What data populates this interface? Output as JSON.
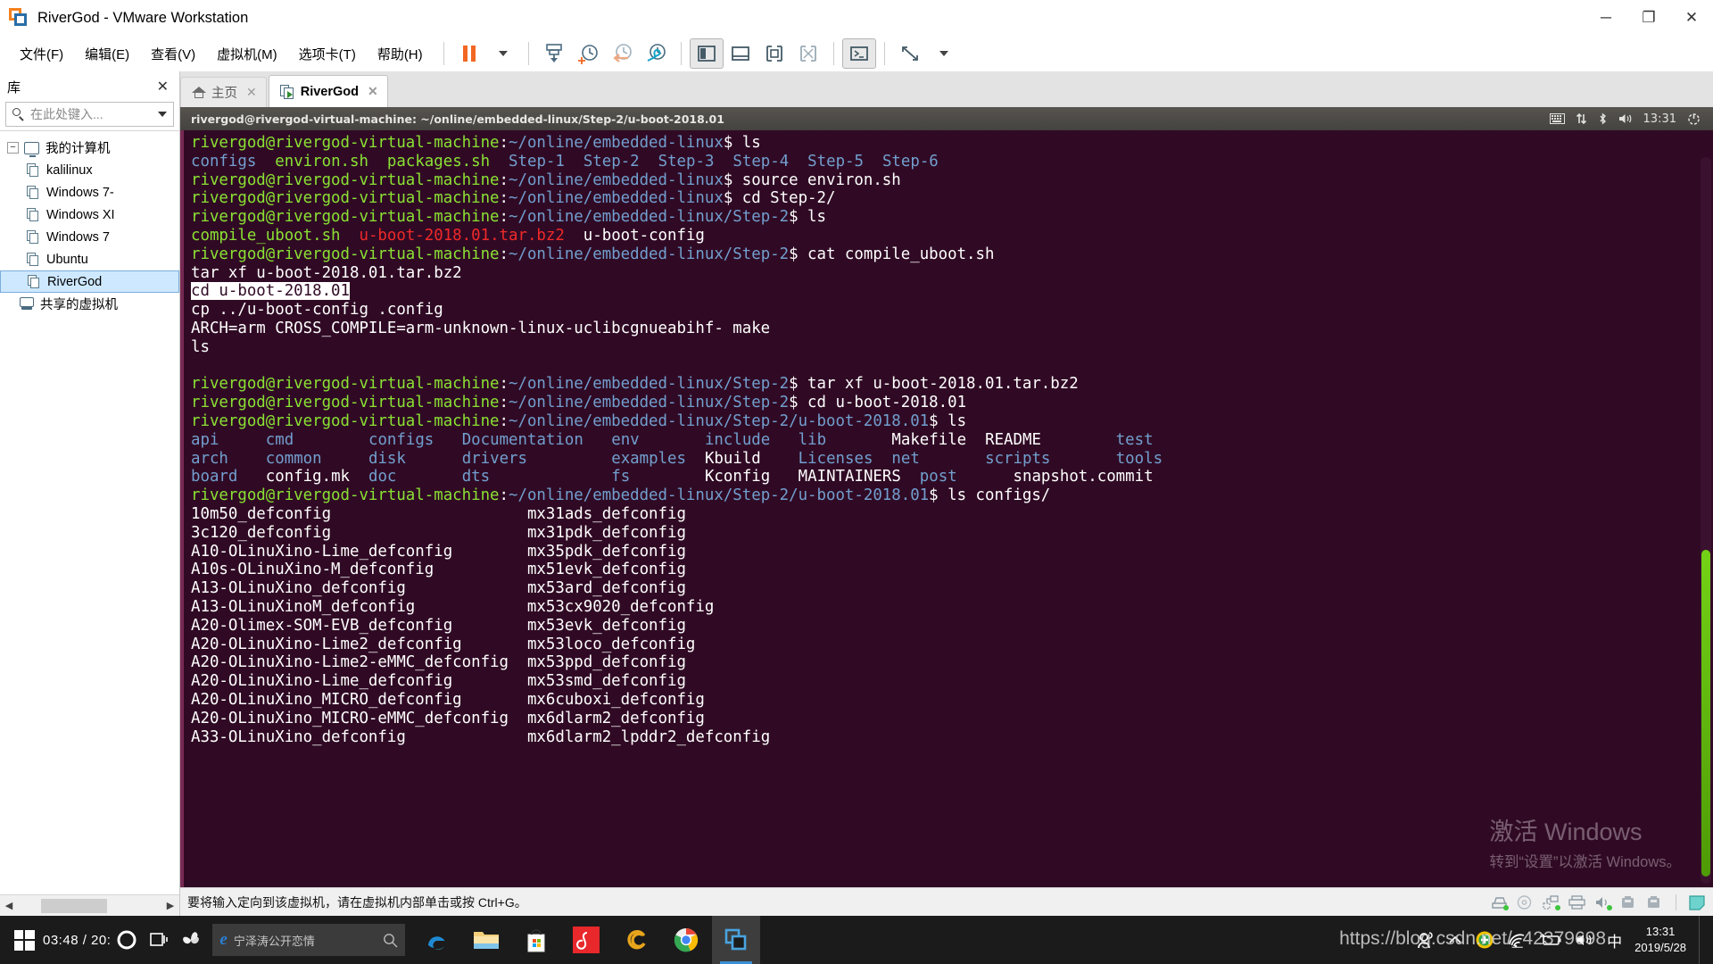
{
  "window": {
    "title": "RiverGod - VMware Workstation",
    "app_icon": "vmware-logo-icon",
    "minimize": "─",
    "maximize": "❐",
    "close": "✕"
  },
  "menubar": {
    "items": [
      {
        "label": "文件(F)",
        "name": "menu-file"
      },
      {
        "label": "编辑(E)",
        "name": "menu-edit"
      },
      {
        "label": "查看(V)",
        "name": "menu-view"
      },
      {
        "label": "虚拟机(M)",
        "name": "menu-vm"
      },
      {
        "label": "选项卡(T)",
        "name": "menu-tabs"
      },
      {
        "label": "帮助(H)",
        "name": "menu-help"
      }
    ],
    "toolbar": [
      {
        "name": "pause-button",
        "icon": "pause-icon"
      },
      {
        "name": "power-dropdown",
        "icon": "chevron-down-icon"
      },
      {
        "name": "send-ctrl-alt-del-button",
        "icon": "send-keys-icon"
      },
      {
        "name": "take-snapshot-button",
        "icon": "snapshot-add-icon"
      },
      {
        "name": "revert-snapshot-button",
        "icon": "snapshot-revert-icon"
      },
      {
        "name": "snapshot-manager-button",
        "icon": "snapshot-manager-icon"
      },
      {
        "name": "show-library-button",
        "icon": "panel-left-icon"
      },
      {
        "name": "show-thumbnails-button",
        "icon": "panel-bottom-icon"
      },
      {
        "name": "show-console-view-button",
        "icon": "console-view-icon"
      },
      {
        "name": "hide-all-panels-button",
        "icon": "panel-hide-icon"
      },
      {
        "name": "unity-mode-button",
        "icon": "terminal-box-icon"
      },
      {
        "name": "fullscreen-button",
        "icon": "fullscreen-icon"
      },
      {
        "name": "fullscreen-dropdown",
        "icon": "chevron-down-icon"
      }
    ]
  },
  "library": {
    "header": "库",
    "close_icon": "close-icon",
    "search_placeholder": "在此处键入...",
    "search_value": "",
    "search_icon": "search-icon",
    "dropdown_icon": "chevron-down-icon",
    "root": {
      "label": "我的计算机",
      "expander": "−",
      "icon": "my-computer-icon"
    },
    "items": [
      {
        "label": "kalilinux",
        "icon": "vm-icon",
        "selected": false
      },
      {
        "label": "Windows 7-",
        "icon": "vm-icon",
        "selected": false
      },
      {
        "label": "Windows XI",
        "icon": "vm-icon",
        "selected": false
      },
      {
        "label": "Windows 7",
        "icon": "vm-icon",
        "selected": false
      },
      {
        "label": "Ubuntu",
        "icon": "vm-icon",
        "selected": false
      },
      {
        "label": "RiverGod",
        "icon": "vm-icon",
        "selected": true
      }
    ],
    "shared": {
      "label": "共享的虚拟机",
      "icon": "shared-vms-icon"
    },
    "scroll_left_icon": "◀",
    "scroll_right_icon": "▶"
  },
  "tabs": [
    {
      "label": "主页",
      "icon": "home-icon",
      "close": "✕",
      "active": false,
      "name": "tab-home"
    },
    {
      "label": "RiverGod",
      "icon": "vm-tab-icon",
      "close": "✕",
      "active": true,
      "name": "tab-rivergod"
    }
  ],
  "guest": {
    "titlebar_text": "rivergod@rivergod-virtual-machine: ~/online/embedded-linux/Step-2/u-boot-2018.01",
    "tray": [
      {
        "name": "keyboard-indicator-icon",
        "glyph": "⌨"
      },
      {
        "name": "network-indicator-icon",
        "glyph": "⇅"
      },
      {
        "name": "bluetooth-indicator-icon",
        "glyph": "✶"
      },
      {
        "name": "volume-indicator-icon",
        "glyph": "🔊"
      }
    ],
    "clock": "13:31",
    "power_icon": "power-gear-icon",
    "watermark": {
      "line1": "激活 Windows",
      "line2": "转到“设置”以激活 Windows。"
    },
    "prompt_user": "rivergod@rivergod-virtual-machine",
    "terminal_lines": [
      [
        {
          "t": "rivergod@rivergod-virtual-machine",
          "c": "green"
        },
        {
          "t": ":",
          "c": "white"
        },
        {
          "t": "~/online/embedded-linux",
          "c": "blue"
        },
        {
          "t": "$ ls",
          "c": "white"
        }
      ],
      [
        {
          "t": "configs",
          "c": "blue"
        },
        {
          "t": "  ",
          "c": "white"
        },
        {
          "t": "environ.sh",
          "c": "green"
        },
        {
          "t": "  ",
          "c": "white"
        },
        {
          "t": "packages.sh",
          "c": "green"
        },
        {
          "t": "  ",
          "c": "white"
        },
        {
          "t": "Step-1",
          "c": "blue"
        },
        {
          "t": "  ",
          "c": "white"
        },
        {
          "t": "Step-2",
          "c": "blue"
        },
        {
          "t": "  ",
          "c": "white"
        },
        {
          "t": "Step-3",
          "c": "blue"
        },
        {
          "t": "  ",
          "c": "white"
        },
        {
          "t": "Step-4",
          "c": "blue"
        },
        {
          "t": "  ",
          "c": "white"
        },
        {
          "t": "Step-5",
          "c": "blue"
        },
        {
          "t": "  ",
          "c": "white"
        },
        {
          "t": "Step-6",
          "c": "blue"
        }
      ],
      [
        {
          "t": "rivergod@rivergod-virtual-machine",
          "c": "green"
        },
        {
          "t": ":",
          "c": "white"
        },
        {
          "t": "~/online/embedded-linux",
          "c": "blue"
        },
        {
          "t": "$ source environ.sh",
          "c": "white"
        }
      ],
      [
        {
          "t": "rivergod@rivergod-virtual-machine",
          "c": "green"
        },
        {
          "t": ":",
          "c": "white"
        },
        {
          "t": "~/online/embedded-linux",
          "c": "blue"
        },
        {
          "t": "$ cd Step-2/",
          "c": "white"
        }
      ],
      [
        {
          "t": "rivergod@rivergod-virtual-machine",
          "c": "green"
        },
        {
          "t": ":",
          "c": "white"
        },
        {
          "t": "~/online/embedded-linux/Step-2",
          "c": "blue"
        },
        {
          "t": "$ ls",
          "c": "white"
        }
      ],
      [
        {
          "t": "compile_uboot.sh",
          "c": "green"
        },
        {
          "t": "  ",
          "c": "white"
        },
        {
          "t": "u-boot-2018.01.tar.bz2",
          "c": "red"
        },
        {
          "t": "  ",
          "c": "white"
        },
        {
          "t": "u-boot-config",
          "c": "white"
        }
      ],
      [
        {
          "t": "rivergod@rivergod-virtual-machine",
          "c": "green"
        },
        {
          "t": ":",
          "c": "white"
        },
        {
          "t": "~/online/embedded-linux/Step-2",
          "c": "blue"
        },
        {
          "t": "$ cat compile_uboot.sh",
          "c": "white"
        }
      ],
      [
        {
          "t": "tar xf u-boot-2018.01.tar.bz2",
          "c": "white"
        }
      ],
      [
        {
          "t": "cd u-boot-2018.01",
          "c": "sel"
        }
      ],
      [
        {
          "t": "cp ../u-boot-config .config",
          "c": "white"
        }
      ],
      [
        {
          "t": "ARCH=arm CROSS_COMPILE=arm-unknown-linux-uclibcgnueabihf- make",
          "c": "white"
        }
      ],
      [
        {
          "t": "ls",
          "c": "white"
        }
      ],
      [
        {
          "t": "",
          "c": "white"
        }
      ],
      [
        {
          "t": "rivergod@rivergod-virtual-machine",
          "c": "green"
        },
        {
          "t": ":",
          "c": "white"
        },
        {
          "t": "~/online/embedded-linux/Step-2",
          "c": "blue"
        },
        {
          "t": "$ tar xf u-boot-2018.01.tar.bz2",
          "c": "white"
        }
      ],
      [
        {
          "t": "rivergod@rivergod-virtual-machine",
          "c": "green"
        },
        {
          "t": ":",
          "c": "white"
        },
        {
          "t": "~/online/embedded-linux/Step-2",
          "c": "blue"
        },
        {
          "t": "$ cd u-boot-2018.01",
          "c": "white"
        }
      ],
      [
        {
          "t": "rivergod@rivergod-virtual-machine",
          "c": "green"
        },
        {
          "t": ":",
          "c": "white"
        },
        {
          "t": "~/online/embedded-linux/Step-2/u-boot-2018.01",
          "c": "blue"
        },
        {
          "t": "$ ls",
          "c": "white"
        }
      ],
      [
        {
          "t": "api",
          "c": "blue"
        },
        {
          "t": "     ",
          "c": "white"
        },
        {
          "t": "cmd",
          "c": "blue"
        },
        {
          "t": "        ",
          "c": "white"
        },
        {
          "t": "configs",
          "c": "blue"
        },
        {
          "t": "   ",
          "c": "white"
        },
        {
          "t": "Documentation",
          "c": "blue"
        },
        {
          "t": "   ",
          "c": "white"
        },
        {
          "t": "env",
          "c": "blue"
        },
        {
          "t": "       ",
          "c": "white"
        },
        {
          "t": "include",
          "c": "blue"
        },
        {
          "t": "   ",
          "c": "white"
        },
        {
          "t": "lib",
          "c": "blue"
        },
        {
          "t": "       ",
          "c": "white"
        },
        {
          "t": "Makefile",
          "c": "white"
        },
        {
          "t": "  ",
          "c": "white"
        },
        {
          "t": "README",
          "c": "white"
        },
        {
          "t": "        ",
          "c": "white"
        },
        {
          "t": "test",
          "c": "blue"
        }
      ],
      [
        {
          "t": "arch",
          "c": "blue"
        },
        {
          "t": "    ",
          "c": "white"
        },
        {
          "t": "common",
          "c": "blue"
        },
        {
          "t": "     ",
          "c": "white"
        },
        {
          "t": "disk",
          "c": "blue"
        },
        {
          "t": "      ",
          "c": "white"
        },
        {
          "t": "drivers",
          "c": "blue"
        },
        {
          "t": "         ",
          "c": "white"
        },
        {
          "t": "examples",
          "c": "blue"
        },
        {
          "t": "  ",
          "c": "white"
        },
        {
          "t": "Kbuild",
          "c": "white"
        },
        {
          "t": "    ",
          "c": "white"
        },
        {
          "t": "Licenses",
          "c": "blue"
        },
        {
          "t": "  ",
          "c": "white"
        },
        {
          "t": "net",
          "c": "blue"
        },
        {
          "t": "       ",
          "c": "white"
        },
        {
          "t": "scripts",
          "c": "blue"
        },
        {
          "t": "       ",
          "c": "white"
        },
        {
          "t": "tools",
          "c": "blue"
        }
      ],
      [
        {
          "t": "board",
          "c": "blue"
        },
        {
          "t": "   ",
          "c": "white"
        },
        {
          "t": "config.mk",
          "c": "white"
        },
        {
          "t": "  ",
          "c": "white"
        },
        {
          "t": "doc",
          "c": "blue"
        },
        {
          "t": "       ",
          "c": "white"
        },
        {
          "t": "dts",
          "c": "blue"
        },
        {
          "t": "             ",
          "c": "white"
        },
        {
          "t": "fs",
          "c": "blue"
        },
        {
          "t": "        ",
          "c": "white"
        },
        {
          "t": "Kconfig",
          "c": "white"
        },
        {
          "t": "   ",
          "c": "white"
        },
        {
          "t": "MAINTAINERS",
          "c": "white"
        },
        {
          "t": "  ",
          "c": "white"
        },
        {
          "t": "post",
          "c": "blue"
        },
        {
          "t": "      ",
          "c": "white"
        },
        {
          "t": "snapshot.commit",
          "c": "white"
        }
      ],
      [
        {
          "t": "rivergod@rivergod-virtual-machine",
          "c": "green"
        },
        {
          "t": ":",
          "c": "white"
        },
        {
          "t": "~/online/embedded-linux/Step-2/u-boot-2018.01",
          "c": "blue"
        },
        {
          "t": "$ ls configs/",
          "c": "white"
        }
      ],
      [
        {
          "t": "10m50_defconfig",
          "c": "white"
        },
        {
          "t": "                     ",
          "c": "white"
        },
        {
          "t": "mx31ads_defconfig",
          "c": "white"
        }
      ],
      [
        {
          "t": "3c120_defconfig",
          "c": "white"
        },
        {
          "t": "                     ",
          "c": "white"
        },
        {
          "t": "mx31pdk_defconfig",
          "c": "white"
        }
      ],
      [
        {
          "t": "A10-OLinuXino-Lime_defconfig",
          "c": "white"
        },
        {
          "t": "        ",
          "c": "white"
        },
        {
          "t": "mx35pdk_defconfig",
          "c": "white"
        }
      ],
      [
        {
          "t": "A10s-OLinuXino-M_defconfig",
          "c": "white"
        },
        {
          "t": "          ",
          "c": "white"
        },
        {
          "t": "mx51evk_defconfig",
          "c": "white"
        }
      ],
      [
        {
          "t": "A13-OLinuXino_defconfig",
          "c": "white"
        },
        {
          "t": "             ",
          "c": "white"
        },
        {
          "t": "mx53ard_defconfig",
          "c": "white"
        }
      ],
      [
        {
          "t": "A13-OLinuXinoM_defconfig",
          "c": "white"
        },
        {
          "t": "            ",
          "c": "white"
        },
        {
          "t": "mx53cx9020_defconfig",
          "c": "white"
        }
      ],
      [
        {
          "t": "A20-Olimex-SOM-EVB_defconfig",
          "c": "white"
        },
        {
          "t": "        ",
          "c": "white"
        },
        {
          "t": "mx53evk_defconfig",
          "c": "white"
        }
      ],
      [
        {
          "t": "A20-OLinuXino-Lime2_defconfig",
          "c": "white"
        },
        {
          "t": "       ",
          "c": "white"
        },
        {
          "t": "mx53loco_defconfig",
          "c": "white"
        }
      ],
      [
        {
          "t": "A20-OLinuXino-Lime2-eMMC_defconfig",
          "c": "white"
        },
        {
          "t": "  ",
          "c": "white"
        },
        {
          "t": "mx53ppd_defconfig",
          "c": "white"
        }
      ],
      [
        {
          "t": "A20-OLinuXino-Lime_defconfig",
          "c": "white"
        },
        {
          "t": "        ",
          "c": "white"
        },
        {
          "t": "mx53smd_defconfig",
          "c": "white"
        }
      ],
      [
        {
          "t": "A20-OLinuXino_MICRO_defconfig",
          "c": "white"
        },
        {
          "t": "       ",
          "c": "white"
        },
        {
          "t": "mx6cuboxi_defconfig",
          "c": "white"
        }
      ],
      [
        {
          "t": "A20-OLinuXino_MICRO-eMMC_defconfig",
          "c": "white"
        },
        {
          "t": "  ",
          "c": "white"
        },
        {
          "t": "mx6dlarm2_defconfig",
          "c": "white"
        }
      ],
      [
        {
          "t": "A33-OLinuXino_defconfig",
          "c": "white"
        },
        {
          "t": "             ",
          "c": "white"
        },
        {
          "t": "mx6dlarm2_lpddr2_defconfig",
          "c": "white"
        }
      ]
    ]
  },
  "vm_status": {
    "message": "要将输入定向到该虚拟机，请在虚拟机内部单击或按 Ctrl+G。",
    "devices": [
      {
        "name": "hard-disk-icon"
      },
      {
        "name": "cd-dvd-icon"
      },
      {
        "name": "network-adapter-icon"
      },
      {
        "name": "printer-icon"
      },
      {
        "name": "sound-card-icon"
      },
      {
        "name": "usb-device-1-icon"
      },
      {
        "name": "usb-device-2-icon"
      },
      {
        "name": "unity-note-icon"
      }
    ]
  },
  "taskbar": {
    "start_icon": "windows-start-icon",
    "clock_overlay": "03:48 / 20:",
    "cortana_icon": "cortana-ring-icon",
    "media_icon": "fan-icon",
    "search": {
      "value": "宁泽涛公开恋情",
      "icon": "edge-icon",
      "search_icon": "search-icon"
    },
    "apps": [
      {
        "name": "edge-taskbar-icon",
        "label": "Microsoft Edge"
      },
      {
        "name": "file-explorer-taskbar-icon",
        "label": "文件资源管理器"
      },
      {
        "name": "microsoft-store-taskbar-icon",
        "label": "Microsoft Store"
      },
      {
        "name": "netease-music-taskbar-icon",
        "label": "网易云音乐"
      },
      {
        "name": "sogou-taskbar-icon",
        "label": "搜狗"
      },
      {
        "name": "chrome-taskbar-icon",
        "label": "Google Chrome"
      },
      {
        "name": "vmware-taskbar-icon",
        "label": "VMware Workstation",
        "active": true
      }
    ],
    "tray": [
      {
        "name": "people-icon"
      },
      {
        "name": "show-hidden-icons-icon"
      },
      {
        "name": "security-shield-icon"
      },
      {
        "name": "wifi-icon"
      },
      {
        "name": "battery-icon"
      },
      {
        "name": "volume-icon"
      },
      {
        "name": "ime-chinese-icon",
        "label": "中"
      }
    ],
    "clock": {
      "time": "13:31",
      "date": "2019/5/28"
    },
    "watermark": "https://blog.csdn.net/_42379698"
  }
}
